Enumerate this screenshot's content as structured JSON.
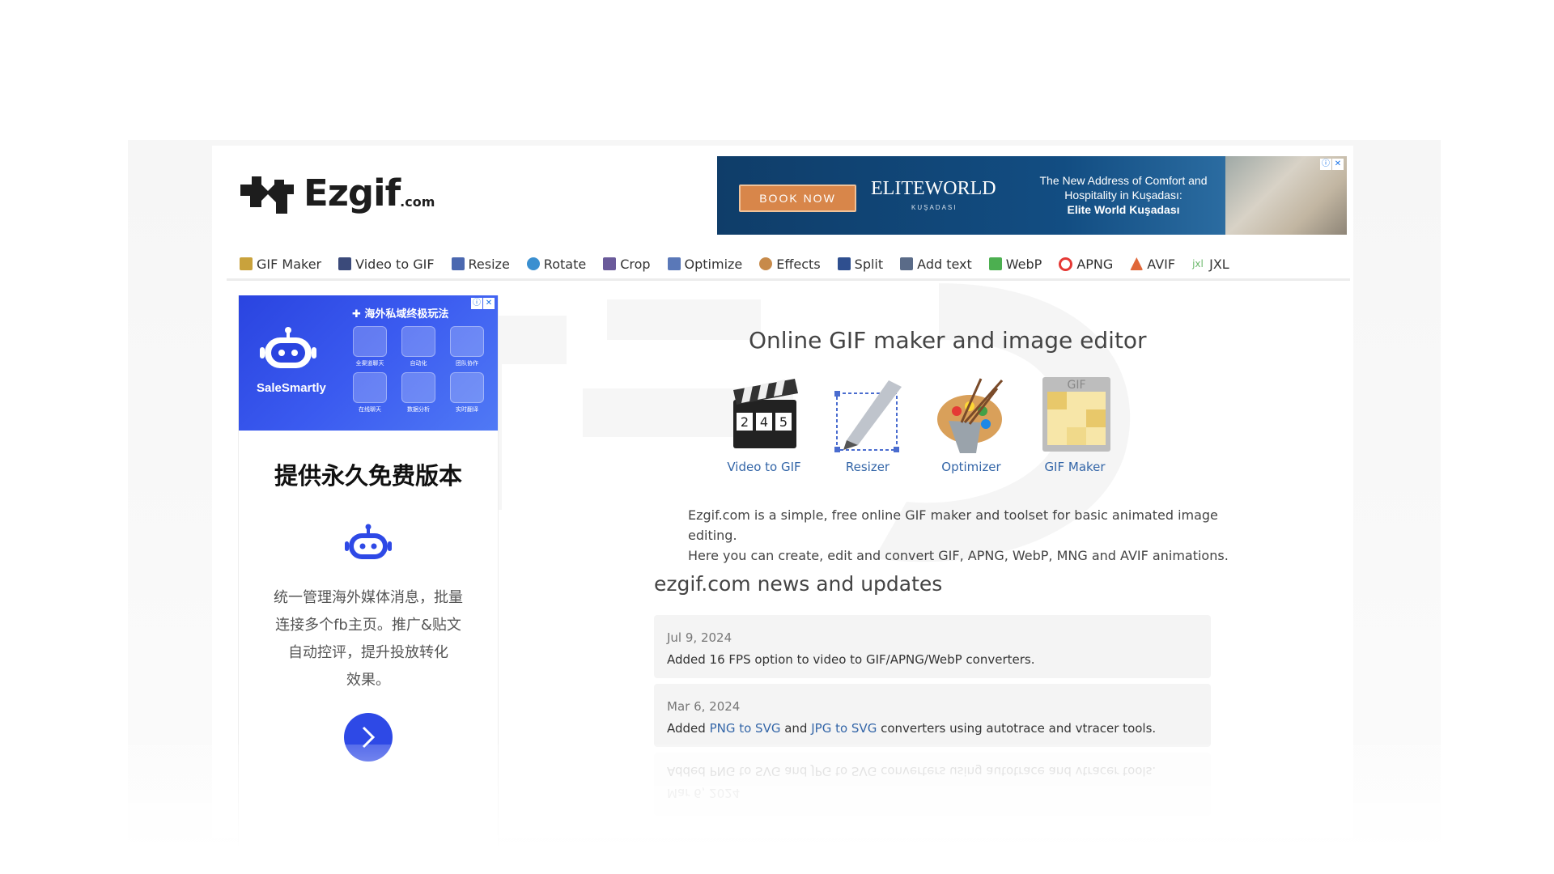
{
  "logo": {
    "word": "Ezgif",
    "tld": ".com"
  },
  "top_ad": {
    "cta": "BOOK NOW",
    "brand": "ELITEWORLD",
    "brand_sub": "KUŞADASI",
    "tagline_1": "The New Address of Comfort and",
    "tagline_2": "Hospitality in Kuşadası:",
    "tagline_3": "Elite World Kuşadası"
  },
  "nav": [
    {
      "label": "GIF Maker",
      "icon": "gif-maker-icon",
      "color": "#c9a23c"
    },
    {
      "label": "Video to GIF",
      "icon": "film-icon",
      "color": "#3b4a7a"
    },
    {
      "label": "Resize",
      "icon": "resize-icon",
      "color": "#4b68b0"
    },
    {
      "label": "Rotate",
      "icon": "rotate-icon",
      "color": "#3a8fd0"
    },
    {
      "label": "Crop",
      "icon": "crop-icon",
      "color": "#6a5a9a"
    },
    {
      "label": "Optimize",
      "icon": "optimize-icon",
      "color": "#5a78b8"
    },
    {
      "label": "Effects",
      "icon": "effects-icon",
      "color": "#c78a4a"
    },
    {
      "label": "Split",
      "icon": "split-icon",
      "color": "#2f4f8f"
    },
    {
      "label": "Add text",
      "icon": "add-text-icon",
      "color": "#5a6b88"
    },
    {
      "label": "WebP",
      "icon": "webp-icon",
      "color": "#4caf50"
    },
    {
      "label": "APNG",
      "icon": "apng-icon",
      "color": "#e53935"
    },
    {
      "label": "AVIF",
      "icon": "avif-icon",
      "color": "#e0683a"
    },
    {
      "label": "JXL",
      "icon": "jxl-icon",
      "color": "#6bb86b"
    }
  ],
  "side_ad": {
    "promo": "✚ 海外私域终极玩法",
    "brand": "SaleSmartly",
    "grid": [
      "全渠道聊天",
      "自动化",
      "团队协作",
      "在线聊天",
      "数据分析",
      "实时翻译"
    ],
    "headline": "提供永久免费版本",
    "body_lines": [
      "统一管理海外媒体消息，批量",
      "连接多个fb主页。推广&贴文",
      "自动控评，提升投放转化",
      "效果。"
    ]
  },
  "main": {
    "title": "Online GIF maker and image editor",
    "tools": [
      {
        "label": "Video to GIF",
        "icon": "clapperboard-icon"
      },
      {
        "label": "Resizer",
        "icon": "resizer-pen-icon"
      },
      {
        "label": "Optimizer",
        "icon": "paint-palette-icon"
      },
      {
        "label": "GIF Maker",
        "icon": "gif-document-icon"
      }
    ],
    "intro_1": "Ezgif.com is a simple, free online GIF maker and toolset for basic animated image editing.",
    "intro_2": "Here you can create, edit and convert GIF, APNG, WebP, MNG and AVIF animations."
  },
  "news": {
    "title": "ezgif.com news and updates",
    "items": [
      {
        "date": "Jul 9, 2024",
        "text": "Added 16 FPS option to video to GIF/APNG/WebP converters."
      },
      {
        "date": "Mar 6, 2024",
        "pre": "Added ",
        "link1": "PNG to SVG",
        "mid": " and ",
        "link2": "JPG to SVG",
        "post": " converters using autotrace and vtracer tools."
      }
    ]
  }
}
